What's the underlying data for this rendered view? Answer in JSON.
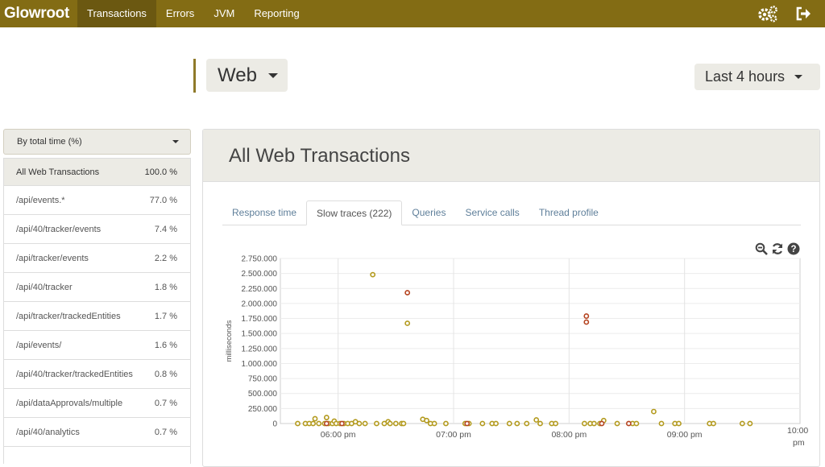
{
  "navbar": {
    "brand": "Glowroot",
    "items": [
      {
        "label": "Transactions",
        "active": true
      },
      {
        "label": "Errors",
        "active": false
      },
      {
        "label": "JVM",
        "active": false
      },
      {
        "label": "Reporting",
        "active": false
      }
    ],
    "icons": [
      "settings-icon",
      "sign-out-icon"
    ]
  },
  "header": {
    "transaction_type": "Web",
    "time_range": "Last 4 hours"
  },
  "sidebar": {
    "sort_by": "By total time (%)",
    "transactions": [
      {
        "name": "All Web Transactions",
        "value": "100.0 %",
        "selected": true
      },
      {
        "name": "/api/events.*",
        "value": "77.0 %"
      },
      {
        "name": "/api/40/tracker/events",
        "value": "7.4 %"
      },
      {
        "name": "/api/tracker/events",
        "value": "2.2 %"
      },
      {
        "name": "/api/40/tracker",
        "value": "1.8 %"
      },
      {
        "name": "/api/tracker/trackedEntities",
        "value": "1.7 %"
      },
      {
        "name": "/api/events/",
        "value": "1.6 %"
      },
      {
        "name": "/api/40/tracker/trackedEntities",
        "value": "0.8 %"
      },
      {
        "name": "/api/dataApprovals/multiple",
        "value": "0.7 %"
      },
      {
        "name": "/api/40/analytics",
        "value": "0.7 %"
      }
    ]
  },
  "main": {
    "title": "All Web Transactions",
    "tabs": [
      {
        "label": "Response time",
        "active": false
      },
      {
        "label": "Slow traces (222)",
        "active": true
      },
      {
        "label": "Queries",
        "active": false
      },
      {
        "label": "Service calls",
        "active": false
      },
      {
        "label": "Thread profile",
        "active": false
      }
    ],
    "tool_icons": [
      "zoom-out-icon",
      "refresh-icon",
      "help-icon"
    ]
  },
  "colors": {
    "navbar": "#836c14",
    "navbar_active": "#6b5811",
    "panel_bg": "#ecebe5",
    "trace_normal": "#b39a1e",
    "trace_error": "#b5431f"
  },
  "chart_data": {
    "type": "scatter",
    "ylabel": "milliseconds",
    "ylim": [
      0,
      2750000
    ],
    "y_ticks": [
      "0",
      "250.000",
      "500.000",
      "750.000",
      "1.000.000",
      "1.250.000",
      "1.500.000",
      "1.750.000",
      "2.000.000",
      "2.250.000",
      "2.500.000",
      "2.750.000"
    ],
    "xlim": [
      "05:30 pm",
      "10:00 pm"
    ],
    "x_ticks": [
      "06:00 pm",
      "07:00 pm",
      "08:00 pm",
      "09:00 pm",
      "10:00 pm"
    ],
    "grid": true,
    "series": [
      {
        "color": "#b39a1e",
        "points": [
          [
            "5:39 pm",
            0
          ],
          [
            "5:43 pm",
            0
          ],
          [
            "5:45 pm",
            0
          ],
          [
            "5:47 pm",
            0
          ],
          [
            "5:48 pm",
            80000
          ],
          [
            "5:50 pm",
            0
          ],
          [
            "5:53 pm",
            0
          ],
          [
            "5:54 pm",
            100000
          ],
          [
            "5:55 pm",
            0
          ],
          [
            "5:57 pm",
            0
          ],
          [
            "5:58 pm",
            40000
          ],
          [
            "5:59 pm",
            0
          ],
          [
            "6:01 pm",
            0
          ],
          [
            "6:03 pm",
            0
          ],
          [
            "6:05 pm",
            0
          ],
          [
            "6:07 pm",
            0
          ],
          [
            "6:09 pm",
            30000
          ],
          [
            "6:11 pm",
            0
          ],
          [
            "6:14 pm",
            0
          ],
          [
            "6:18 pm",
            2480000
          ],
          [
            "6:20 pm",
            0
          ],
          [
            "6:24 pm",
            0
          ],
          [
            "6:26 pm",
            30000
          ],
          [
            "6:27 pm",
            0
          ],
          [
            "6:30 pm",
            0
          ],
          [
            "6:33 pm",
            0
          ],
          [
            "6:34 pm",
            0
          ],
          [
            "6:36 pm",
            1670000
          ],
          [
            "6:44 pm",
            70000
          ],
          [
            "6:46 pm",
            50000
          ],
          [
            "6:48 pm",
            0
          ],
          [
            "6:50 pm",
            0
          ],
          [
            "6:56 pm",
            0
          ],
          [
            "7:06 pm",
            0
          ],
          [
            "7:08 pm",
            0
          ],
          [
            "7:15 pm",
            0
          ],
          [
            "7:20 pm",
            0
          ],
          [
            "7:22 pm",
            0
          ],
          [
            "7:29 pm",
            0
          ],
          [
            "7:33 pm",
            0
          ],
          [
            "7:38 pm",
            0
          ],
          [
            "7:43 pm",
            60000
          ],
          [
            "7:45 pm",
            0
          ],
          [
            "7:51 pm",
            0
          ],
          [
            "7:53 pm",
            0
          ],
          [
            "8:08 pm",
            0
          ],
          [
            "8:11 pm",
            0
          ],
          [
            "8:13 pm",
            0
          ],
          [
            "8:16 pm",
            0
          ],
          [
            "8:18 pm",
            50000
          ],
          [
            "8:25 pm",
            0
          ],
          [
            "8:33 pm",
            0
          ],
          [
            "8:35 pm",
            0
          ],
          [
            "8:44 pm",
            200000
          ],
          [
            "8:48 pm",
            0
          ],
          [
            "8:55 pm",
            0
          ],
          [
            "8:57 pm",
            0
          ],
          [
            "9:13 pm",
            0
          ],
          [
            "9:15 pm",
            0
          ],
          [
            "9:30 pm",
            0
          ],
          [
            "9:34 pm",
            0
          ]
        ]
      },
      {
        "color": "#b5431f",
        "points": [
          [
            "6:36 pm",
            2180000
          ],
          [
            "8:09 pm",
            1790000
          ],
          [
            "8:09 pm",
            1690000
          ],
          [
            "5:54 pm",
            0
          ],
          [
            "6:02 pm",
            0
          ],
          [
            "7:07 pm",
            0
          ],
          [
            "8:17 pm",
            0
          ],
          [
            "8:31 pm",
            0
          ]
        ]
      }
    ]
  }
}
